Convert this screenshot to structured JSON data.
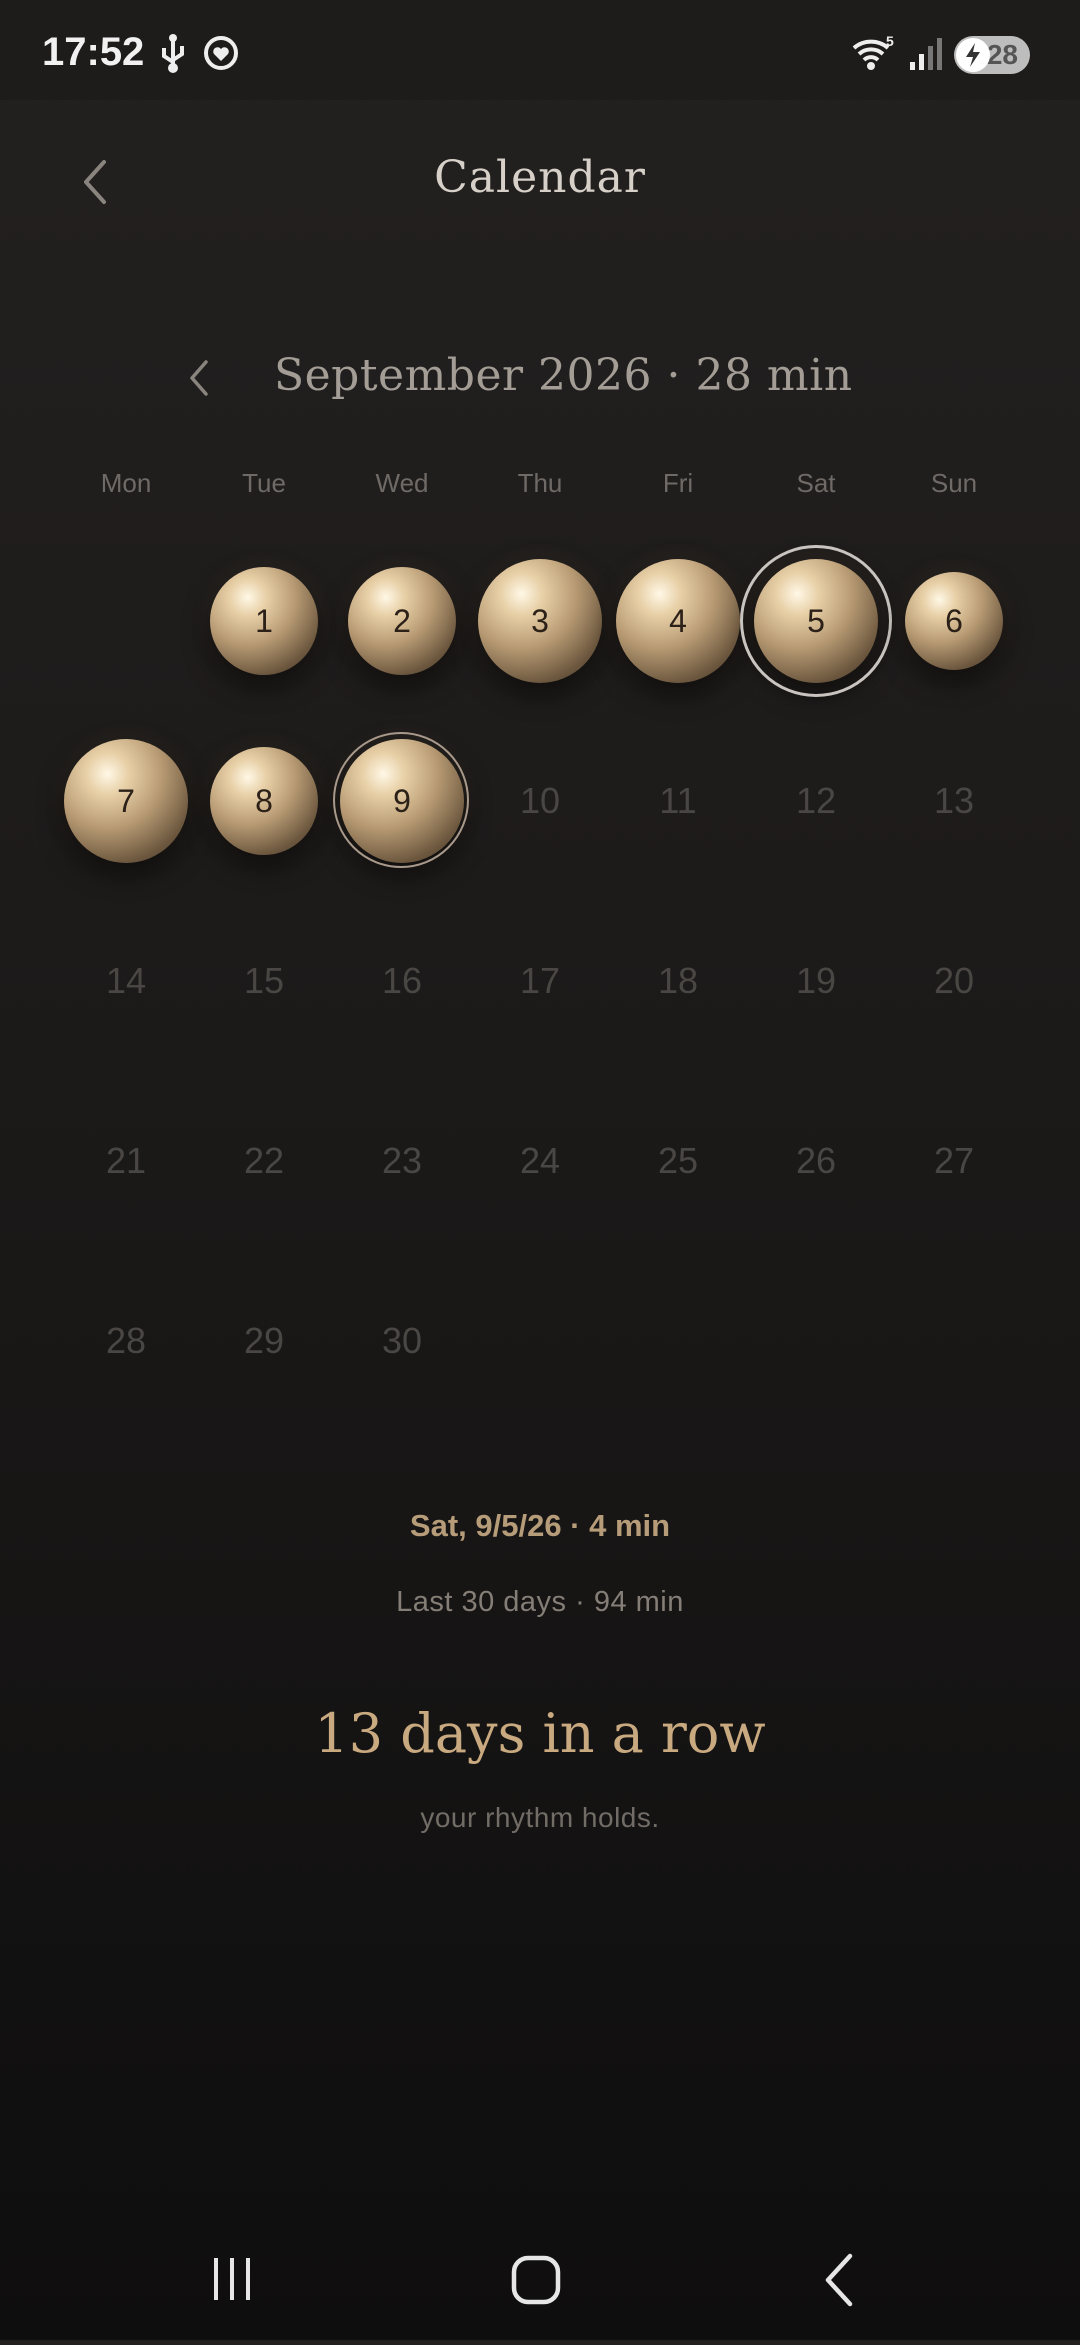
{
  "status_bar": {
    "time": "17:52",
    "battery_level": "28",
    "network_badge": "5",
    "icons": [
      "usb-icon",
      "heart-circle-icon",
      "wifi-icon",
      "signal-icon",
      "battery-charging-icon"
    ]
  },
  "header": {
    "title": "Calendar",
    "back_icon": "chevron-left-icon"
  },
  "month": {
    "label": "September 2026 · 28 min",
    "prev_icon": "chevron-left-icon"
  },
  "weekdays": [
    "Mon",
    "Tue",
    "Wed",
    "Thu",
    "Fri",
    "Sat",
    "Sun"
  ],
  "calendar": {
    "first_weekday_offset": 1,
    "days_in_month": 30,
    "active_days": {
      "1": {
        "size": "medium"
      },
      "2": {
        "size": "medium"
      },
      "3": {
        "size": "large"
      },
      "4": {
        "size": "large"
      },
      "5": {
        "size": "large",
        "selected": true
      },
      "6": {
        "size": "small"
      },
      "7": {
        "size": "large"
      },
      "8": {
        "size": "medium"
      },
      "9": {
        "size": "large",
        "ringed": true
      }
    },
    "days": [
      "1",
      "2",
      "3",
      "4",
      "5",
      "6",
      "7",
      "8",
      "9",
      "10",
      "11",
      "12",
      "13",
      "14",
      "15",
      "16",
      "17",
      "18",
      "19",
      "20",
      "21",
      "22",
      "23",
      "24",
      "25",
      "26",
      "27",
      "28",
      "29",
      "30"
    ]
  },
  "summary": {
    "selected_info": "Sat, 9/5/26 · 4 min",
    "last_30_days": "Last 30 days · 94 min",
    "streak": "13 days in a row",
    "tagline": "your rhythm holds."
  },
  "nav_bar": {
    "recents_icon": "recents-icon",
    "home_icon": "home-icon",
    "back_icon": "back-icon"
  },
  "colors": {
    "accent": "#c9a97f",
    "pearl": "#b89b74",
    "background": "#1c1a19"
  }
}
